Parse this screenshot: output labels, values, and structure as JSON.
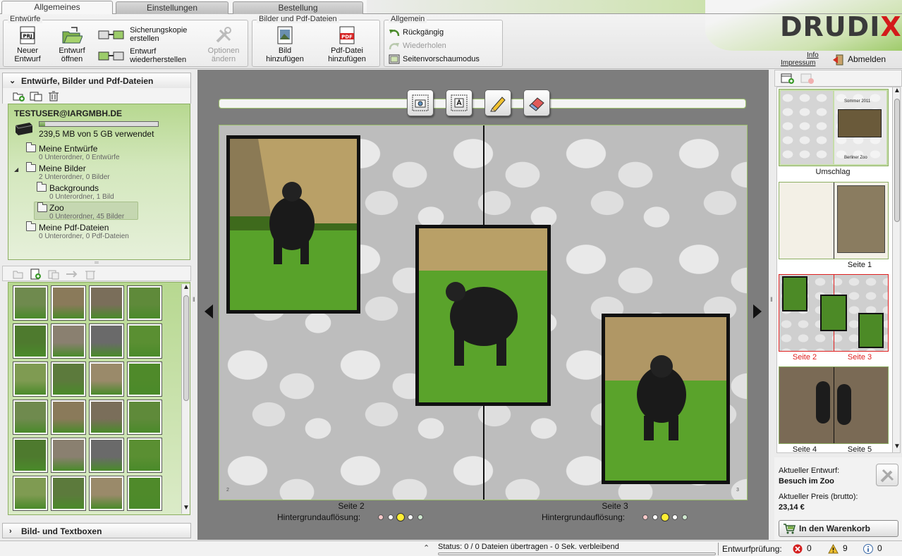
{
  "tabs": [
    "Allgemeines",
    "Einstellungen",
    "Bestellung"
  ],
  "brand": {
    "logo_text": "DRUDI",
    "logo_x": "X",
    "accent": "#8bbf55",
    "logo_red": "#d31a1a"
  },
  "ribbon": {
    "entwuerfe": {
      "label": "Entwürfe",
      "new_l1": "Neuer",
      "new_l2": "Entwurf",
      "open_l1": "Entwurf",
      "open_l2": "öffnen",
      "backup_l1": "Sicherungskopie",
      "backup_l2": "erstellen",
      "restore_l1": "Entwurf",
      "restore_l2": "wiederherstellen",
      "options_l1": "Optionen",
      "options_l2": "ändern"
    },
    "media": {
      "label": "Bilder und Pdf-Dateien",
      "image_l1": "Bild",
      "image_l2": "hinzufügen",
      "pdf_l1": "Pdf-Datei",
      "pdf_l2": "hinzufügen",
      "pdf_icon_text": "PDF",
      "prj_icon_text": "PRJ"
    },
    "general": {
      "label": "Allgemein",
      "undo": "Rückgängig",
      "redo": "Wiederholen",
      "preview": "Seitenvorschaumodus"
    }
  },
  "userlinks": {
    "info": "Info",
    "impressum": "Impressum",
    "logout": "Abmelden"
  },
  "left": {
    "header": "Entwürfe, Bilder und Pdf-Dateien",
    "user": "TESTUSER@IARGMBH.DE",
    "storage_text": "239,5 MB von 5 GB verwendet",
    "storage_fraction": 0.05,
    "tree": [
      {
        "name": "Meine Entwürfe",
        "sub": "0 Unterordner, 0 Entwürfe"
      },
      {
        "name": "Meine Bilder",
        "sub": "2 Unterordner, 0 Bilder"
      },
      {
        "name": "Backgrounds",
        "sub": "0 Unterordner, 1 Bild"
      },
      {
        "name": "Zoo",
        "sub": "0 Unterordner, 45 Bilder"
      },
      {
        "name": "Meine Pdf-Dateien",
        "sub": "0 Unterordner, 0 Pdf-Dateien"
      }
    ],
    "bottom_header": "Bild- und Textboxen"
  },
  "center": {
    "pages": [
      {
        "caption": "Seite 2",
        "num": "2"
      },
      {
        "caption": "Seite 3",
        "num": "3"
      }
    ],
    "resolution_label": "Hintergrundauflösung:"
  },
  "right": {
    "pages": [
      "Umschlag",
      "Seite 1",
      "Seite 2",
      "Seite 3",
      "Seite 4",
      "Seite 5"
    ],
    "cover_title": "Sommer 2011",
    "cover_subtitle": "Berliner Zoo",
    "current_label": "Aktueller Entwurf:",
    "current_value": "Besuch im Zoo",
    "price_label": "Aktueller Preis (brutto):",
    "price_value": "23,14 €",
    "cart": "In den Warenkorb"
  },
  "status": {
    "text": "Status: 0 / 0 Dateien übertragen - 0 Sek. verbleibend",
    "check_label": "Entwurfprüfung:",
    "errors": "0",
    "warnings": "9",
    "infos": "0"
  }
}
